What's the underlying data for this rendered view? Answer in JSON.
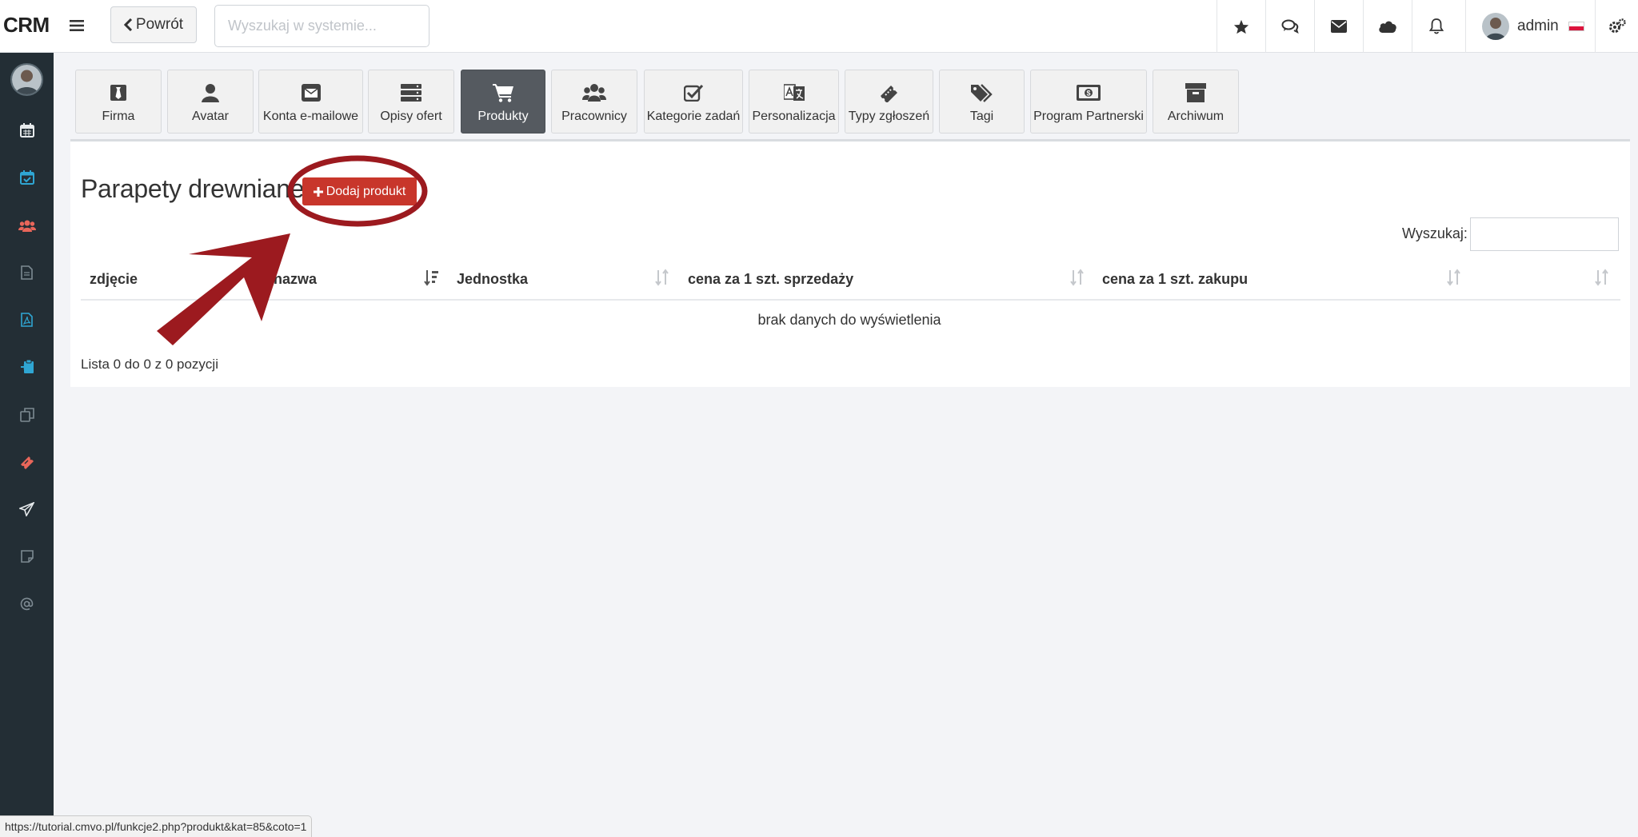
{
  "app": {
    "brand": "CRM"
  },
  "topbar": {
    "back_label": "Powrót",
    "search_placeholder": "Wyszukaj w systemie...",
    "icons": [
      "star-icon",
      "comments-icon",
      "envelope-icon",
      "cloud-icon",
      "bell-icon"
    ],
    "user_name": "admin"
  },
  "sidebar": {
    "items": [
      {
        "icon": "calendar-icon",
        "color": "#e6eaec"
      },
      {
        "icon": "calendar-check-icon",
        "color": "#2fa6d3"
      },
      {
        "icon": "users-icon",
        "color": "#e9665a"
      },
      {
        "icon": "file-icon",
        "color": "#7d8a92"
      },
      {
        "icon": "file-pdf-icon",
        "color": "#2fa6d3"
      },
      {
        "icon": "clipboard-icon",
        "color": "#2fa6d3"
      },
      {
        "icon": "copy-icon",
        "color": "#7d8a92"
      },
      {
        "icon": "ticket-icon",
        "color": "#e9665a"
      },
      {
        "icon": "paper-plane-icon",
        "color": "#e6eaec"
      },
      {
        "icon": "note-icon",
        "color": "#7d8a92"
      },
      {
        "icon": "at-icon",
        "color": "#7d8a92"
      }
    ]
  },
  "tabs": [
    {
      "label": "Firma",
      "icon": "tie-icon"
    },
    {
      "label": "Avatar",
      "icon": "user-icon"
    },
    {
      "label": "Konta e-mailowe",
      "icon": "envelope-square-icon"
    },
    {
      "label": "Opisy ofert",
      "icon": "server-icon"
    },
    {
      "label": "Produkty",
      "icon": "cart-icon",
      "active": true
    },
    {
      "label": "Pracownicy",
      "icon": "users-icon"
    },
    {
      "label": "Kategorie zadań",
      "icon": "check-square-icon"
    },
    {
      "label": "Personalizacja",
      "icon": "language-icon"
    },
    {
      "label": "Typy zgłoszeń",
      "icon": "ticket-icon"
    },
    {
      "label": "Tagi",
      "icon": "tags-icon"
    },
    {
      "label": "Program Partnerski",
      "icon": "money-icon"
    },
    {
      "label": "Archiwum",
      "icon": "archive-icon"
    }
  ],
  "main": {
    "title": "Parapety drewniane",
    "add_button": "Dodaj produkt",
    "search_label": "Wyszukaj:",
    "columns": [
      "zdjęcie",
      "nazwa",
      "Jednostka",
      "cena za 1 szt. sprzedaży",
      "cena za 1 szt. zakupu",
      ""
    ],
    "empty_message": "brak danych do wyświetlenia",
    "info": "Lista 0 do 0 z 0 pozycji"
  },
  "status_url": "https://tutorial.cmvo.pl/funkcje2.php?produkt&kat=85&coto=1",
  "colors": {
    "accent": "#c8362b",
    "annotation": "#9c1a1f",
    "sidebar_bg": "#232e35",
    "active_tab": "#555a60"
  }
}
